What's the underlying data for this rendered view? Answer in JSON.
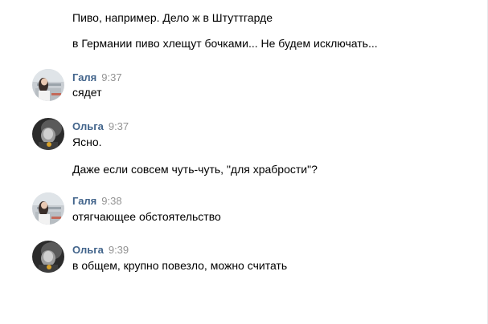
{
  "messages": [
    {
      "continuation": [
        "Пиво, например. Дело ж в Штуттгарде",
        "в Германии пиво хлещут бочками... Не будем исключать..."
      ]
    },
    {
      "author": "Галя",
      "time": "9:37",
      "texts": [
        "сядет"
      ]
    },
    {
      "author": "Ольга",
      "time": "9:37",
      "texts": [
        "Ясно.",
        "Даже если совсем чуть-чуть, \"для храбрости\"?"
      ]
    },
    {
      "author": "Галя",
      "time": "9:38",
      "texts": [
        "отягчающее обстоятельство"
      ]
    },
    {
      "author": "Ольга",
      "time": "9:39",
      "texts": [
        "в общем, крупно повезло, можно считать"
      ]
    }
  ],
  "colors": {
    "author_name": "#42648b",
    "timestamp": "#939393",
    "text": "#000000",
    "background": "#ffffff"
  },
  "icons": {
    "galya_avatar": "avatar-photo-icon",
    "olga_avatar": "avatar-photo-icon"
  }
}
